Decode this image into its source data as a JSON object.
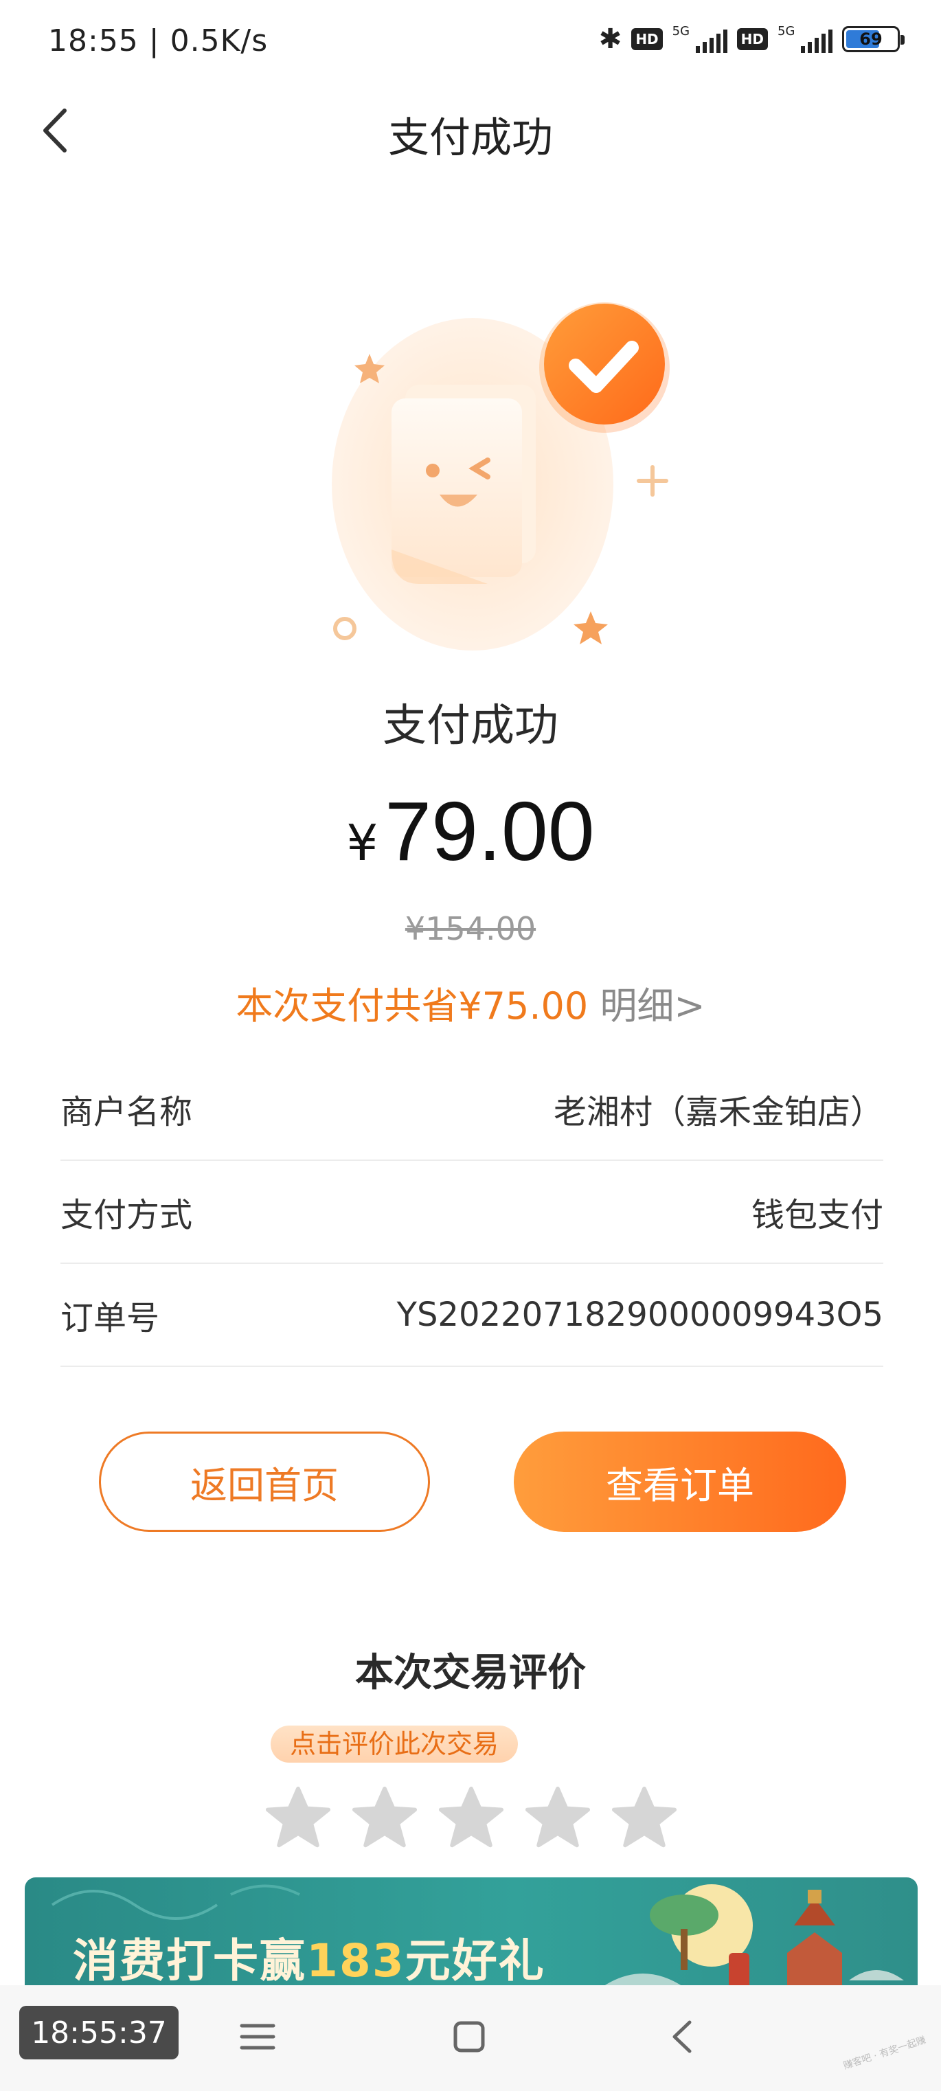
{
  "status_bar": {
    "time": "18:55 | 0.5K/s",
    "bluetooth_icon": "bluetooth-icon",
    "hd_label": "HD",
    "network_label": "5G",
    "battery": "69"
  },
  "header": {
    "title": "支付成功",
    "back_icon": "chevron-left-icon"
  },
  "result": {
    "title": "支付成功",
    "currency_symbol": "¥",
    "amount": "79.00",
    "original_price": "¥154.00",
    "saving_text": "本次支付共省¥75.00",
    "detail_link": "明细>"
  },
  "details": [
    {
      "label": "商户名称",
      "value": "老湘村（嘉禾金铂店）"
    },
    {
      "label": "支付方式",
      "value": "钱包支付"
    },
    {
      "label": "订单号",
      "value": "YS2022071829000009943O5"
    }
  ],
  "buttons": {
    "home": "返回首页",
    "order": "查看订单"
  },
  "review": {
    "title": "本次交易评价",
    "hint": "点击评价此次交易",
    "star_count": 5,
    "rating": 0
  },
  "banner": {
    "text_prefix": "消费打卡赢",
    "text_highlight": "183",
    "text_suffix": "元好礼"
  },
  "navbar": {
    "clock": "18:55:37"
  },
  "watermark": "赚客吧 · 有奖一起赚",
  "colors": {
    "accent": "#f07a1c",
    "accent_gradient_start": "#ff9d3c",
    "accent_gradient_end": "#ff6a1d",
    "banner_bg": "#2f9892"
  }
}
